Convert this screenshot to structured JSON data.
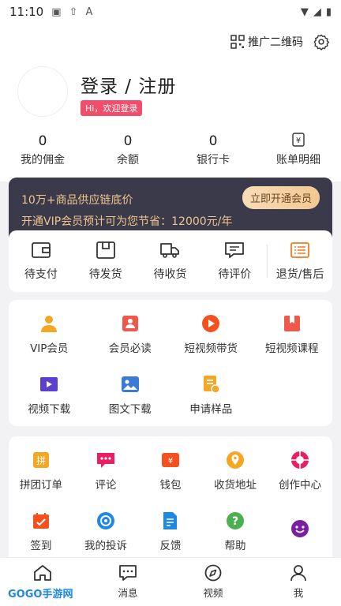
{
  "status_bar": {
    "time": "11:10"
  },
  "header": {
    "qr_label": "推广二维码",
    "login_title": "登录 / 注册",
    "welcome": "Hi，欢迎登录"
  },
  "stats": [
    {
      "num": "0",
      "label": "我的佣金"
    },
    {
      "num": "0",
      "label": "余额"
    },
    {
      "num": "0",
      "label": "银行卡"
    },
    {
      "num": "",
      "label": "账单明细"
    }
  ],
  "vip": {
    "line1": "10万+商品供应链底价",
    "line2": "开通VIP会员预计可为您节省：12000元/年",
    "button": "立即开通会员"
  },
  "orders": [
    {
      "label": "待支付",
      "icon": "wallet-icon"
    },
    {
      "label": "待发货",
      "icon": "box-icon"
    },
    {
      "label": "待收货",
      "icon": "truck-icon"
    },
    {
      "label": "待评价",
      "icon": "comment-icon"
    },
    {
      "label": "退货/售后",
      "icon": "list-icon"
    }
  ],
  "services": [
    {
      "label": "VIP会员",
      "icon": "vip-user-icon",
      "color": "#f5a623"
    },
    {
      "label": "会员必读",
      "icon": "member-read-icon",
      "color": "#f0584b"
    },
    {
      "label": "短视频带货",
      "icon": "play-icon",
      "color": "#f4511e"
    },
    {
      "label": "短视频课程",
      "icon": "bookmark-icon",
      "color": "#f0584b"
    },
    {
      "label": "视频下载",
      "icon": "video-icon",
      "color": "#5b3fd1"
    },
    {
      "label": "图文下载",
      "icon": "image-icon",
      "color": "#3a7bd5"
    },
    {
      "label": "申请样品",
      "icon": "sample-icon",
      "color": "#f5a623"
    }
  ],
  "tools": [
    {
      "label": "拼团订单",
      "icon": "group-order-icon",
      "color": "#f5a623"
    },
    {
      "label": "评论",
      "icon": "chat-icon",
      "color": "#e91e63"
    },
    {
      "label": "钱包",
      "icon": "wallet2-icon",
      "color": "#f4511e"
    },
    {
      "label": "收货地址",
      "icon": "location-icon",
      "color": "#f5a623"
    },
    {
      "label": "创作中心",
      "icon": "aperture-icon",
      "color": "#e91e63"
    },
    {
      "label": "签到",
      "icon": "calendar-icon",
      "color": "#f4511e"
    },
    {
      "label": "我的投诉",
      "icon": "target-icon",
      "color": "#1e88e5"
    },
    {
      "label": "反馈",
      "icon": "doc-edit-icon",
      "color": "#1e88e5"
    },
    {
      "label": "帮助",
      "icon": "help-icon",
      "color": "#4caf50"
    },
    {
      "label": "",
      "icon": "smile-icon",
      "color": "#7b1fa2"
    }
  ],
  "tabs": [
    {
      "label": "主页",
      "icon": "home-icon"
    },
    {
      "label": "消息",
      "icon": "message-icon"
    },
    {
      "label": "视频",
      "icon": "compass-icon"
    },
    {
      "label": "我",
      "icon": "user-icon"
    }
  ],
  "watermark": "GOGO手游网"
}
